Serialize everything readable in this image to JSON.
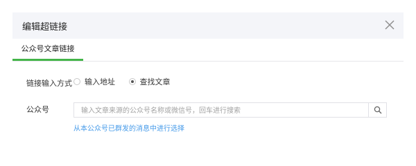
{
  "dialog": {
    "title": "编辑超链接",
    "close_icon": "close-icon"
  },
  "tabs": [
    {
      "label": "公众号文章链接",
      "active": true
    }
  ],
  "form": {
    "link_method": {
      "label": "链接输入方式",
      "options": [
        {
          "label": "输入地址",
          "checked": false
        },
        {
          "label": "查找文章",
          "checked": true
        }
      ]
    },
    "account": {
      "label": "公众号",
      "placeholder": "输入文章来源的公众号名称或微信号，回车进行搜索",
      "value": "",
      "search_icon": "search-icon"
    },
    "select_from_sent_link": "从本公众号已群发的消息中进行选择"
  },
  "colors": {
    "accent": "#44b549",
    "link": "#459ae9",
    "header_bg": "#f4f5f9"
  }
}
